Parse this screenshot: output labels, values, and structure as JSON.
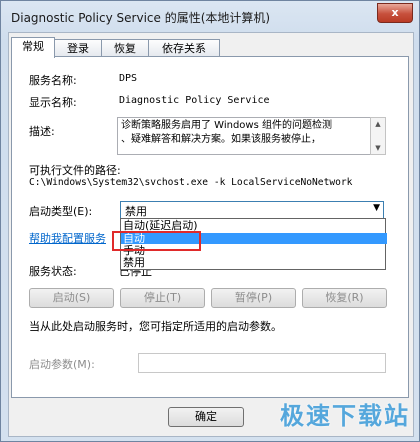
{
  "window": {
    "title": "Diagnostic Policy Service 的属性(本地计算机)",
    "close_label": "x"
  },
  "tabs": [
    {
      "label": "常规",
      "active": true
    },
    {
      "label": "登录",
      "active": false
    },
    {
      "label": "恢复",
      "active": false
    },
    {
      "label": "依存关系",
      "active": false
    }
  ],
  "general": {
    "service_name_label": "服务名称:",
    "service_name": "DPS",
    "display_name_label": "显示名称:",
    "display_name": "Diagnostic Policy Service",
    "description_label": "描述:",
    "description_line1": "诊断策略服务启用了 Windows 组件的问题检测",
    "description_line2": "、疑难解答和解决方案。如果该服务被停止，",
    "exe_path_label": "可执行文件的路径:",
    "exe_path": "C:\\Windows\\System32\\svchost.exe -k LocalServiceNoNetwork",
    "startup_type_label": "启动类型(E):",
    "startup_type_value": "禁用",
    "startup_options": [
      "自动(延迟启动)",
      "自动",
      "手动",
      "禁用"
    ],
    "highlighted_option_index": 1,
    "help_link": "帮助我配置服务",
    "status_label": "服务状态:",
    "status_value": "已停止"
  },
  "service_buttons": {
    "start": "启动(S)",
    "stop": "停止(T)",
    "pause": "暂停(P)",
    "resume": "恢复(R)"
  },
  "start_params_hint": "当从此处启动服务时，您可指定所适用的启动参数。",
  "start_params_label": "启动参数(M):",
  "start_params_value": "",
  "footer": {
    "ok": "确定"
  },
  "watermark": "极速下载站"
}
